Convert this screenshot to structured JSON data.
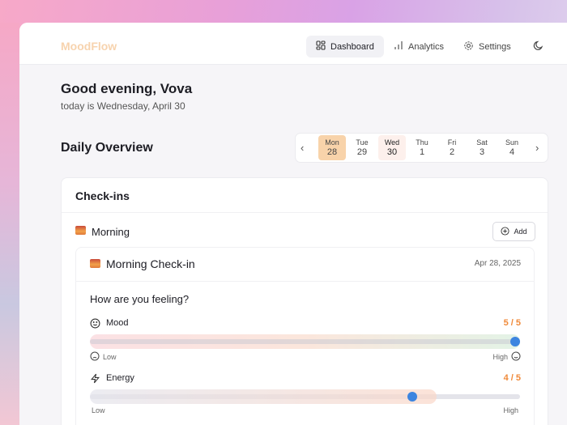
{
  "app": {
    "name": "MoodFlow"
  },
  "nav": {
    "items": [
      {
        "label": "Dashboard",
        "icon": "grid-icon",
        "active": true
      },
      {
        "label": "Analytics",
        "icon": "bar-chart-icon"
      },
      {
        "label": "Settings",
        "icon": "gear-icon"
      }
    ],
    "theme_icon": "moon-icon"
  },
  "greeting": {
    "title": "Good evening, Vova",
    "subtitle": "today is Wednesday, April 30"
  },
  "overview": {
    "title": "Daily Overview",
    "days": [
      {
        "dow": "Mon",
        "num": "28",
        "state": "selected"
      },
      {
        "dow": "Tue",
        "num": "29"
      },
      {
        "dow": "Wed",
        "num": "30",
        "state": "today"
      },
      {
        "dow": "Thu",
        "num": "1"
      },
      {
        "dow": "Fri",
        "num": "2"
      },
      {
        "dow": "Sat",
        "num": "3"
      },
      {
        "dow": "Sun",
        "num": "4"
      }
    ]
  },
  "checkins": {
    "title": "Check-ins",
    "section": "Morning",
    "add_label": "Add",
    "entry": {
      "title": "Morning Check-in",
      "date": "Apr 28, 2025",
      "question": "How are you feeling?",
      "metrics": [
        {
          "label": "Mood",
          "value": "5 / 5",
          "fraction": 1.0,
          "low": "Low",
          "high": "High"
        },
        {
          "label": "Energy",
          "value": "4 / 5",
          "fraction": 0.75,
          "low": "Low",
          "high": "High"
        }
      ]
    }
  },
  "colors": {
    "accent": "#3d85e0",
    "value": "#f08a3a",
    "selected_day": "#f8d3aa",
    "today_day": "#fdf0ec"
  }
}
